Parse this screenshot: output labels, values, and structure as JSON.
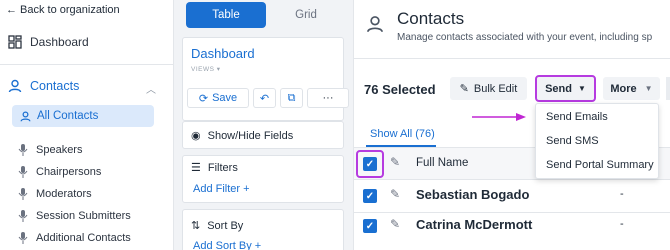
{
  "sidebar": {
    "back_label": "Back to organization",
    "dashboard_label": "Dashboard",
    "contacts_label": "Contacts",
    "items": [
      {
        "label": "All Contacts"
      },
      {
        "label": "Speakers"
      },
      {
        "label": "Chairpersons"
      },
      {
        "label": "Moderators"
      },
      {
        "label": "Session Submitters"
      },
      {
        "label": "Additional Contacts"
      }
    ]
  },
  "views_panel": {
    "tabs": [
      {
        "label": "Table"
      },
      {
        "label": "Grid"
      }
    ],
    "active_tab": "Table",
    "view_name": "Dashboard",
    "views_label": "VIEWS",
    "save_label": "Save",
    "more_label": "···",
    "show_hide_label": "Show/Hide Fields",
    "filters_label": "Filters",
    "add_filter_label": "Add Filter",
    "sort_by_label": "Sort By",
    "add_sort_label": "Add Sort By"
  },
  "main": {
    "title": "Contacts",
    "subtitle": "Manage contacts associated with your event, including sp",
    "selected_label": "76 Selected",
    "bulk_edit_label": "Bulk Edit",
    "send_label": "Send",
    "more_label": "More",
    "show_all_label": "Show All (76)",
    "column_header": "Full Name",
    "rows": [
      {
        "name": "Sebastian Bogado",
        "value": "-"
      },
      {
        "name": "Catrina McDermott",
        "value": "-"
      }
    ],
    "send_menu": [
      {
        "label": "Send Emails"
      },
      {
        "label": "Send SMS"
      },
      {
        "label": "Send Portal Summary"
      }
    ]
  },
  "colors": {
    "accent": "#1a6fd1",
    "highlight": "#b63be0",
    "panel_bg": "#f1f3f6"
  }
}
